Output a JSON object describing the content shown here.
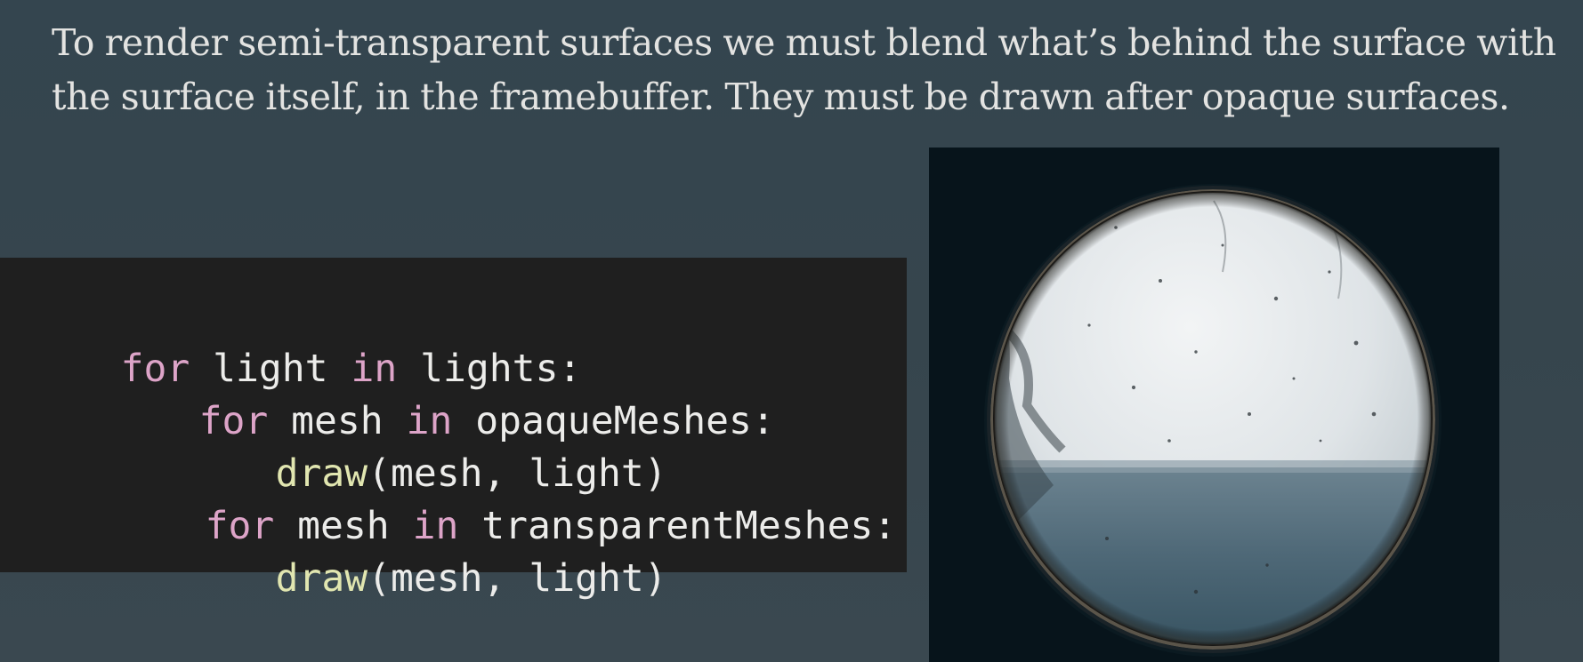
{
  "intro_text": "To render semi-transparent surfaces we must blend what’s behind the surface with the surface itself, in the framebuffer. They must be drawn after opaque surfaces.",
  "code": {
    "lines": [
      {
        "indent": "",
        "parts": [
          {
            "text": "for",
            "kind": "keyword"
          },
          {
            "text": " light ",
            "kind": "plain"
          },
          {
            "text": "in",
            "kind": "keyword"
          },
          {
            "text": " lights:",
            "kind": "plain"
          }
        ]
      },
      {
        "indent": "   ",
        "parts": [
          {
            "text": "for",
            "kind": "keyword"
          },
          {
            "text": " mesh ",
            "kind": "plain"
          },
          {
            "text": "in",
            "kind": "keyword"
          },
          {
            "text": " opaqueMeshes:",
            "kind": "plain"
          }
        ]
      },
      {
        "indent": "      ",
        "parts": [
          {
            "text": "draw",
            "kind": "function"
          },
          {
            "text": "(mesh, light)",
            "kind": "plain"
          }
        ]
      },
      {
        "indent": "   ",
        "parts": [
          {
            "text": "for",
            "kind": "keyword"
          },
          {
            "text": " mesh ",
            "kind": "plain"
          },
          {
            "text": "in",
            "kind": "keyword"
          },
          {
            "text": " transparentMeshes:",
            "kind": "plain"
          }
        ]
      },
      {
        "indent": "      ",
        "parts": [
          {
            "text": "draw",
            "kind": "function"
          },
          {
            "text": "(mesh, light)",
            "kind": "plain"
          }
        ]
      }
    ]
  },
  "colors": {
    "background": "#36454d",
    "code_background": "#1f1f1f",
    "keyword": "#dda4c8",
    "function": "#e1e6b0",
    "plain_code": "#ececea",
    "body_text": "#e3e3e1"
  },
  "photo": {
    "icon": "porthole-window-photo"
  }
}
